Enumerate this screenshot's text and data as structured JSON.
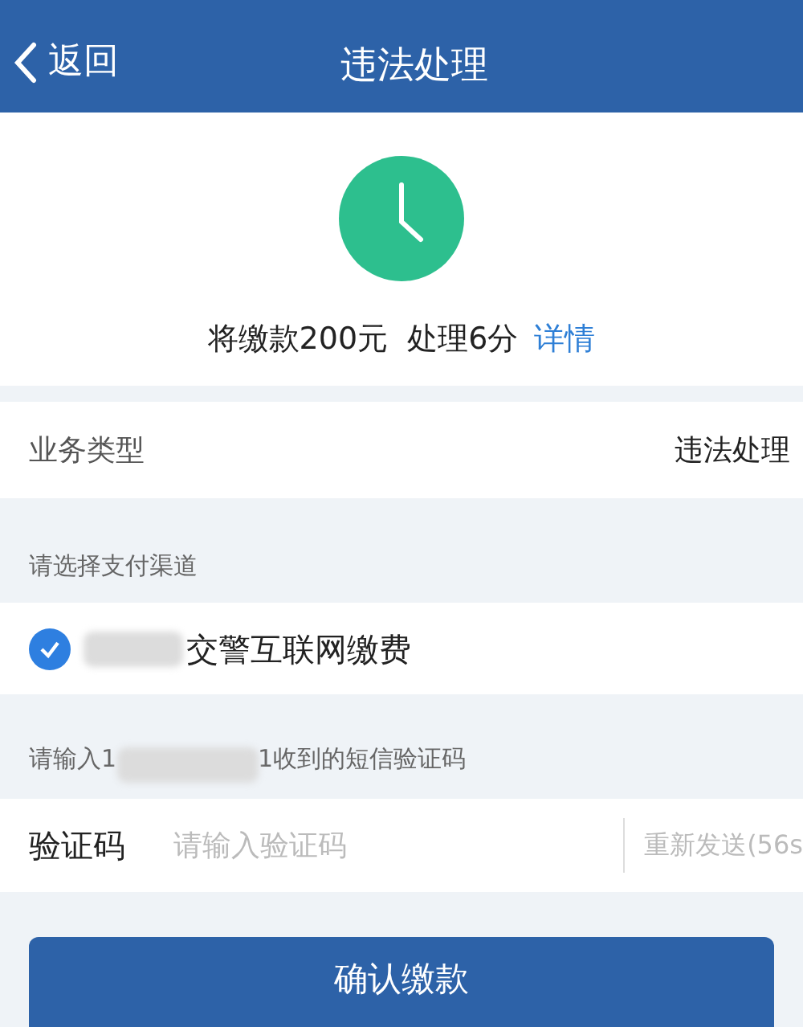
{
  "nav": {
    "back": "返回",
    "title": "违法处理"
  },
  "summary": {
    "text": "将缴款200元  处理6分",
    "link": "详情"
  },
  "business": {
    "label": "业务类型",
    "value": "违法处理"
  },
  "channel_heading": "请选择支付渠道",
  "channels": [
    {
      "label": "交警互联网缴费",
      "selected": true
    }
  ],
  "sms_hint": {
    "before": "请输入1",
    "after": "1收到的短信验证码"
  },
  "code_field": {
    "label": "验证码",
    "placeholder": "请输入验证码",
    "resend": "重新发送(56s"
  },
  "confirm_button": "确认缴款"
}
